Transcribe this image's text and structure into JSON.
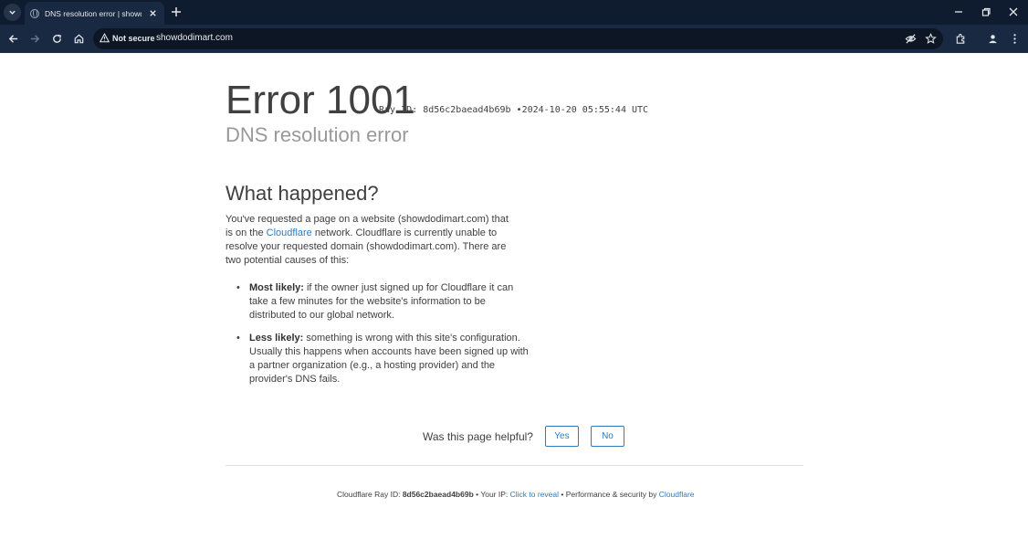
{
  "browser": {
    "tab": {
      "title": "DNS resolution error | showdodimart.com"
    },
    "address_bar": {
      "security_label": "Not secure",
      "url": "showdodimart.com"
    }
  },
  "page": {
    "error_title": "Error 1001",
    "ray_header": {
      "ray_label": "Ray ID:",
      "ray_id": "8d56c2baead4b69b",
      "separator": "•",
      "timestamp": "2024-10-20 05:55:44 UTC"
    },
    "error_subtitle": "DNS resolution error",
    "heading": "What happened?",
    "paragraph": {
      "before_link": "You've requested a page on a website (showdodimart.com) that is on the ",
      "link": "Cloudflare",
      "after_link": " network. Cloudflare is currently unable to resolve your requested domain (showdodimart.com). There are two potential causes of this:"
    },
    "causes": [
      {
        "label": "Most likely:",
        "text": " if the owner just signed up for Cloudflare it can take a few minutes for the website's information to be distributed to our global network."
      },
      {
        "label": "Less likely:",
        "text": " something is wrong with this site's configuration. Usually this happens when accounts have been signed up with a partner organization (e.g., a hosting provider) and the provider's DNS fails."
      }
    ],
    "feedback": {
      "question": "Was this page helpful?",
      "yes": "Yes",
      "no": "No"
    },
    "footer": {
      "ray_label": "Cloudflare Ray ID: ",
      "ray_id": "8d56c2baead4b69b",
      "sep1": " • ",
      "ip_label": "Your IP: ",
      "ip_link": "Click to reveal",
      "sep2": " • ",
      "perf_label": "Performance & security by ",
      "perf_link": "Cloudflare"
    }
  },
  "colors": {
    "chrome_dark": "#0f1b2e",
    "chrome_toolbar": "#1a2942",
    "link": "#2f7bbf",
    "text": "#404040",
    "subtitle": "#999999"
  }
}
